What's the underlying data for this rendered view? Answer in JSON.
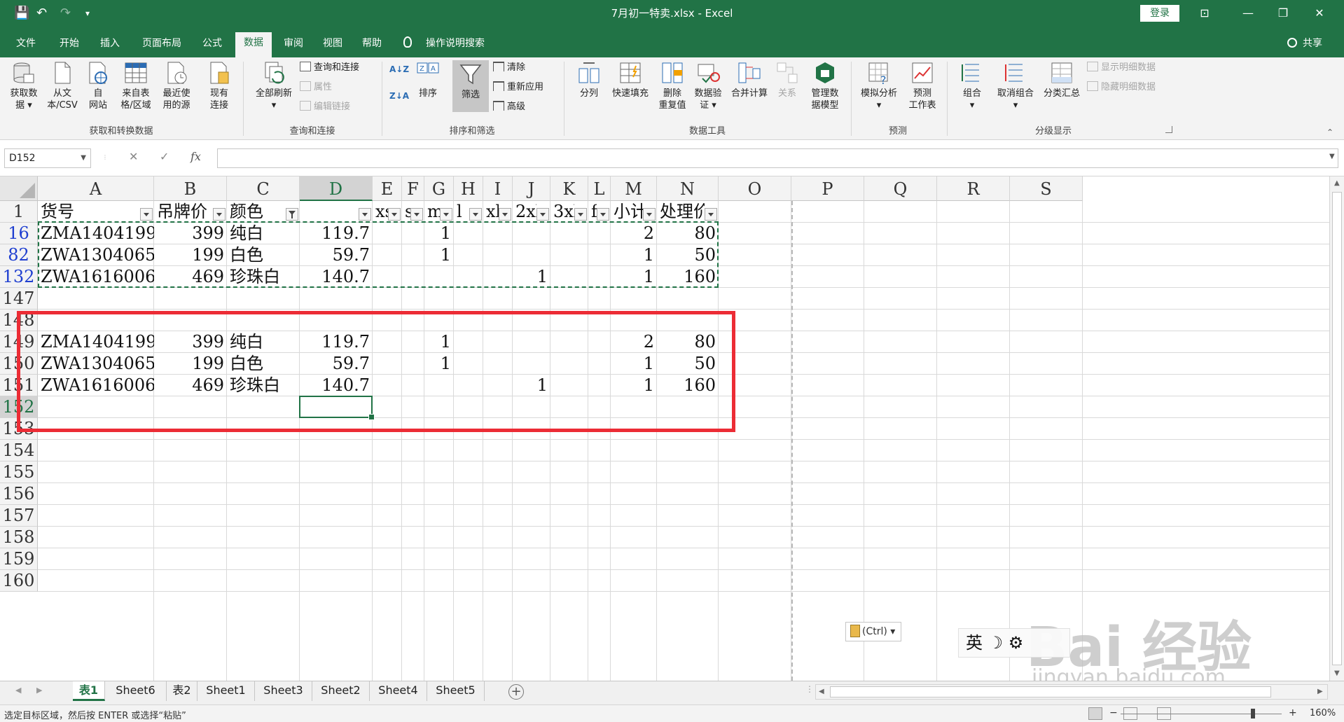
{
  "window": {
    "title": "7月初一特卖.xlsx  -  Excel",
    "login_label": "登录",
    "qa_save": "💾",
    "qa_undo": "↶",
    "qa_redo": "↷",
    "qa_more": "▾",
    "win_restore_ribbon": "⊡",
    "win_minimize": "—",
    "win_maximize": "❐",
    "win_close": "✕"
  },
  "menu": {
    "tabs": [
      "文件",
      "开始",
      "插入",
      "页面布局",
      "公式",
      "数据",
      "审阅",
      "视图",
      "帮助"
    ],
    "active_tab": "数据",
    "tell_me": "操作说明搜索",
    "share": "共享"
  },
  "ribbon": {
    "get_data": "获取数\n据 ▾",
    "from_csv": "从文\n本/CSV",
    "from_web": "自\n网站",
    "from_table": "来自表\n格/区域",
    "recent_sources": "最近使\n用的源",
    "existing_connections": "现有\n连接",
    "group_get_transform": "获取和转换数据",
    "refresh_all": "全部刷新\n▾",
    "queries_connections": "查询和连接",
    "properties": "属性",
    "edit_links": "编辑链接",
    "group_queries": "查询和连接",
    "sort_az": "A↓Z",
    "sort_za": "Z↓A",
    "sort": "排序",
    "filter": "筛选",
    "clear": "清除",
    "reapply": "重新应用",
    "advanced": "高级",
    "group_sort_filter": "排序和筛选",
    "text_to_columns": "分列",
    "flash_fill": "快速填充",
    "remove_duplicates": "删除\n重复值",
    "data_validation": "数据验\n证 ▾",
    "consolidate": "合并计算",
    "relationships": "关系",
    "manage_data_model": "管理数\n据模型",
    "group_data_tools": "数据工具",
    "what_if": "模拟分析\n▾",
    "forecast_sheet": "预测\n工作表",
    "group_forecast": "预测",
    "group_btn": "组合\n▾",
    "ungroup": "取消组合\n▾",
    "subtotal": "分类汇总",
    "show_detail": "显示明细数据",
    "hide_detail": "隐藏明细数据",
    "group_outline": "分级显示"
  },
  "formula_bar": {
    "name_box": "D152",
    "cancel_icon": "✕",
    "enter_icon": "✓",
    "fx_icon": "fx",
    "formula": ""
  },
  "grid": {
    "columns": [
      "A",
      "B",
      "C",
      "D",
      "E",
      "F",
      "G",
      "H",
      "I",
      "J",
      "K",
      "L",
      "M",
      "N",
      "O",
      "P",
      "Q",
      "R",
      "S"
    ],
    "selected_column": "D",
    "row_numbers": [
      "1",
      "16",
      "82",
      "132",
      "147",
      "148",
      "149",
      "150",
      "151",
      "152",
      "153",
      "154",
      "155",
      "156",
      "157",
      "158",
      "159",
      "160"
    ],
    "header_row": {
      "A": "货号",
      "B": "吊牌价",
      "C": "颜色",
      "D": "",
      "E": "xs",
      "F": "s",
      "G": "m",
      "H": "l",
      "I": "xl",
      "J": "2xl",
      "K": "3xl",
      "L": "f",
      "M": "小计",
      "N": "处理价"
    },
    "rows": [
      {
        "row": "16",
        "A": "ZMA1404199",
        "B": "399",
        "C": "纯白",
        "D": "119.7",
        "G": "1",
        "J": "",
        "M": "2",
        "N": "80"
      },
      {
        "row": "82",
        "A": "ZWA1304065",
        "B": "199",
        "C": "白色",
        "D": "59.7",
        "G": "1",
        "J": "",
        "M": "1",
        "N": "50"
      },
      {
        "row": "132",
        "A": "ZWA1616006",
        "B": "469",
        "C": "珍珠白",
        "D": "140.7",
        "G": "",
        "J": "1",
        "M": "1",
        "N": "160"
      },
      {
        "row": "147"
      },
      {
        "row": "148"
      },
      {
        "row": "149",
        "A": "ZMA1404199",
        "B": "399",
        "C": "纯白",
        "D": "119.7",
        "G": "1",
        "J": "",
        "M": "2",
        "N": "80"
      },
      {
        "row": "150",
        "A": "ZWA1304065",
        "B": "199",
        "C": "白色",
        "D": "59.7",
        "G": "1",
        "J": "",
        "M": "1",
        "N": "50"
      },
      {
        "row": "151",
        "A": "ZWA1616006",
        "B": "469",
        "C": "珍珠白",
        "D": "140.7",
        "G": "",
        "J": "1",
        "M": "1",
        "N": "160"
      }
    ],
    "paste_options": "(Ctrl) ▾",
    "ime_label": "英 ☽ ⚙"
  },
  "watermark": {
    "brand": "Bai 经验",
    "url": "jingyan.baidu.com"
  },
  "sheet_tabs": {
    "tabs": [
      "表1",
      "Sheet6",
      "表2",
      "Sheet1",
      "Sheet3",
      "Sheet2",
      "Sheet4",
      "Sheet5"
    ],
    "active": "表1",
    "add": "+",
    "nav_prev": "◀",
    "nav_next": "▶"
  },
  "status_bar": {
    "message": "选定目标区域，然后按 ENTER 或选择“粘贴”",
    "zoom": "160%",
    "zoom_minus": "−",
    "zoom_plus": "+"
  },
  "colors": {
    "excel_green": "#217346",
    "annotation_red": "#ec2c35",
    "filtered_row_blue": "#1f3fd0"
  }
}
